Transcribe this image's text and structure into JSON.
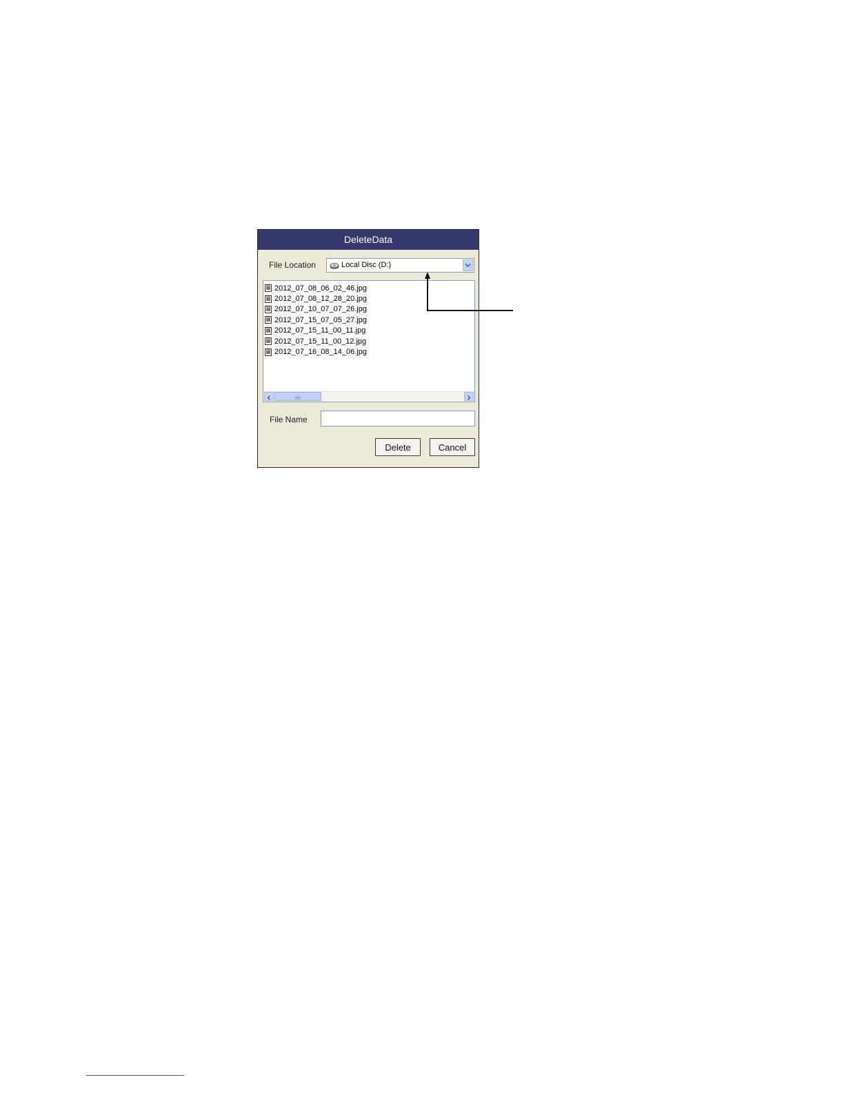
{
  "dialog": {
    "title": "DeleteData",
    "file_location": {
      "label": "File Location",
      "value": "Local Disc (D:)"
    },
    "files": [
      "2012_07_08_06_02_46.jpg",
      "2012_07_08_12_28_20.jpg",
      "2012_07_10_07_07_26.jpg",
      "2012_07_15_07_05_27.jpg",
      "2012_07_15_11_00_11.jpg",
      "2012_07_15_11_00_12.jpg",
      "2012_07_16_08_14_06.jpg"
    ],
    "file_name": {
      "label": "File Name",
      "value": ""
    },
    "buttons": {
      "delete": "Delete",
      "cancel": "Cancel"
    }
  },
  "icons": {
    "drive": "hard-drive-icon",
    "file": "image-file-icon",
    "dropdown": "chevron-down-icon",
    "scroll_left": "chevron-left-icon",
    "scroll_right": "chevron-right-icon"
  },
  "colors": {
    "titlebar": "#333a6b",
    "dialog_bg": "#ece9d8",
    "control_border": "#7f9db9",
    "scroll_accent": "#c6d3f7"
  }
}
